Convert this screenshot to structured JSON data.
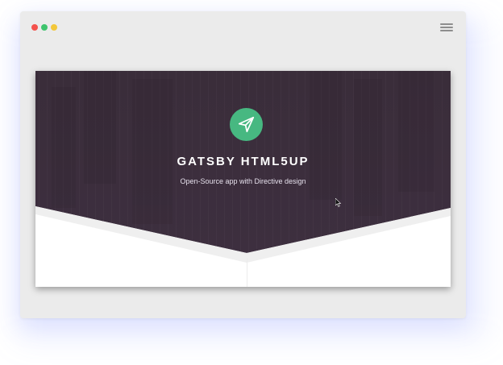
{
  "window": {
    "controls": [
      {
        "name": "close",
        "color": "#f4524d"
      },
      {
        "name": "minimize",
        "color": "#3ec46d"
      },
      {
        "name": "maximize",
        "color": "#f3c73a"
      }
    ],
    "menu_icon": "hamburger-menu-icon"
  },
  "banner": {
    "background": "#3c2e3d",
    "logo_icon": "paper-plane-icon",
    "logo_color": "#47b881",
    "title": "GATSBY HTML5UP",
    "subtitle": "Open-Source app with Directive design"
  },
  "cursor_icon": "mouse-pointer-icon"
}
